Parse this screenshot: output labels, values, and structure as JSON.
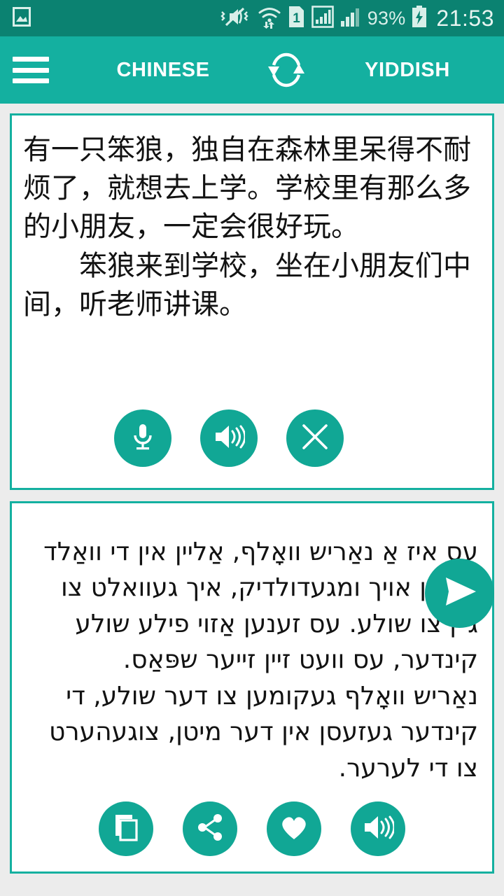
{
  "colors": {
    "status_bar_bg": "#0b8271",
    "app_bar_bg": "#14b0a0",
    "accent": "#11a795",
    "page_bg": "#ececec",
    "card_bg": "#ffffff",
    "card_border": "#14b0a0",
    "text": "#121212"
  },
  "status_bar": {
    "icons": [
      "gallery-icon",
      "vibrate-mute-icon",
      "wifi-data-icon",
      "sim-1-icon",
      "signal-bars-1-icon",
      "signal-bars-2-icon"
    ],
    "sim_label": "1",
    "battery_percent": "93%",
    "battery_state": "charging",
    "clock": "21:53"
  },
  "app_bar": {
    "menu_icon": "hamburger-menu-icon",
    "source_language": "CHINESE",
    "swap_icon": "swap-languages-icon",
    "target_language": "YIDDISH"
  },
  "source_card": {
    "text": "有一只笨狼，独自在森林里呆得不耐烦了，就想去上学。学校里有那么多的小朋友，一定会很好玩。\n　　笨狼来到学校，坐在小朋友们中间，听老师讲课。",
    "buttons": [
      {
        "name": "microphone-button",
        "icon": "microphone-icon",
        "label": "Voice input"
      },
      {
        "name": "speak-source-button",
        "icon": "speaker-icon",
        "label": "Listen"
      },
      {
        "name": "clear-button",
        "icon": "close-x-icon",
        "label": "Clear"
      }
    ]
  },
  "translate_button": {
    "name": "translate-send-button",
    "icon": "send-paper-plane-icon",
    "label": "Translate"
  },
  "target_card": {
    "text": "עס איז אַ נאַריש וואָלף, אַליין אין די וואַלד בלײַבן אויך ומגעדולדיק, איך געוואלט צו גיין צו שולע. עס זענען אַזוי פילע שולע קינדער, עס וועט זיין זייער שפּאַס.\nנאַריש וואָלף געקומען צו דער שולע, די קינדער געזעסן אין דער מיטן, צוגעהערט צו די לערער.",
    "buttons": [
      {
        "name": "copy-button",
        "icon": "copy-icon",
        "label": "Copy"
      },
      {
        "name": "share-button",
        "icon": "share-icon",
        "label": "Share"
      },
      {
        "name": "favorite-button",
        "icon": "heart-icon",
        "label": "Favorite"
      },
      {
        "name": "speak-target-button",
        "icon": "speaker-icon",
        "label": "Listen"
      }
    ]
  }
}
